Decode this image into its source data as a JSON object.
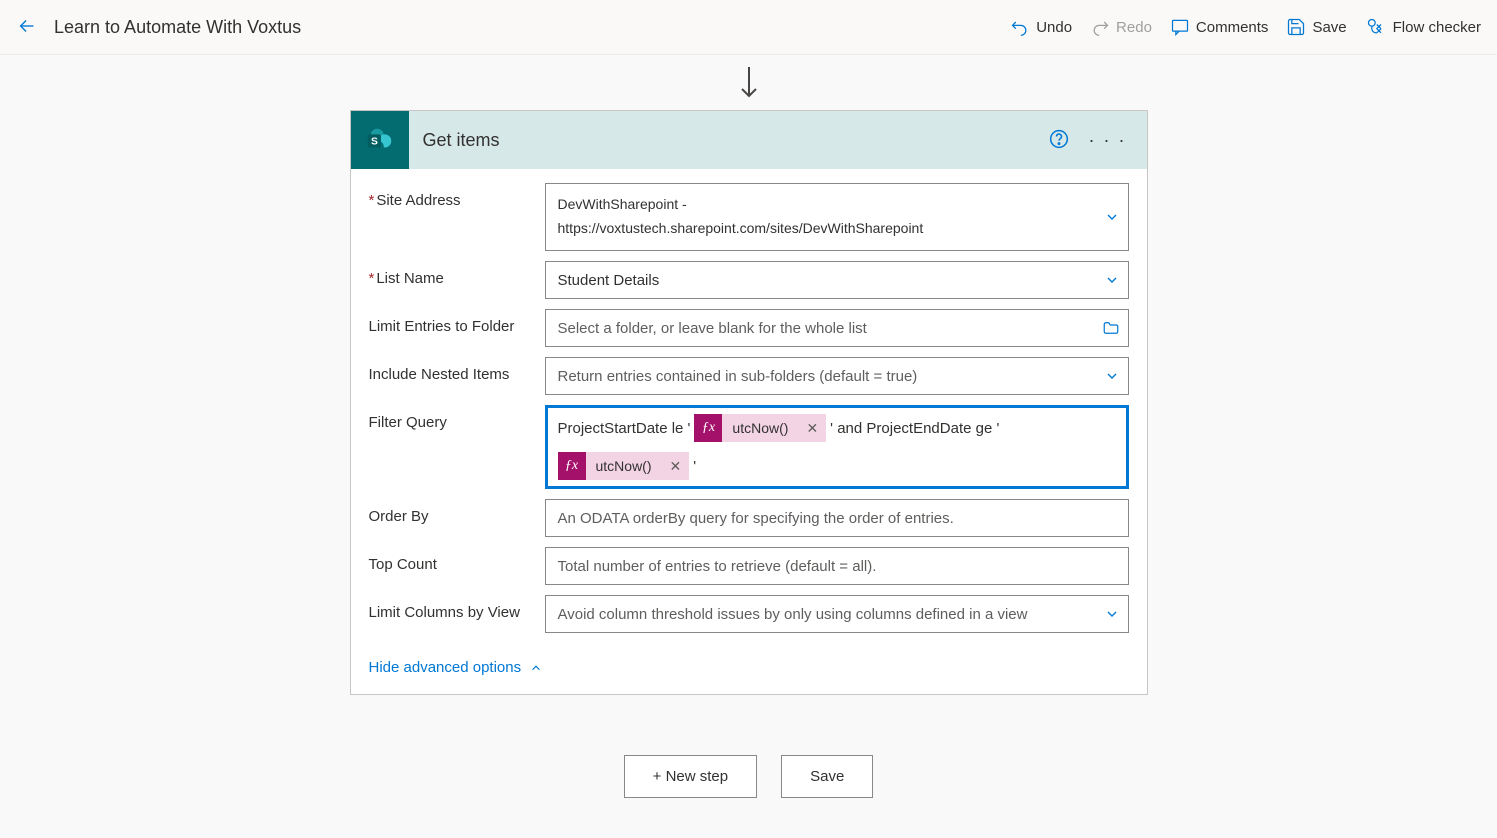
{
  "topbar": {
    "title": "Learn to Automate With Voxtus",
    "undo": "Undo",
    "redo": "Redo",
    "comments": "Comments",
    "save": "Save",
    "flow_checker": "Flow checker"
  },
  "action": {
    "title": "Get items",
    "fields": {
      "site_address": {
        "label": "Site Address",
        "value_line1": "DevWithSharepoint -",
        "value_line2": "https://voxtustech.sharepoint.com/sites/DevWithSharepoint"
      },
      "list_name": {
        "label": "List Name",
        "value": "Student Details"
      },
      "limit_folder": {
        "label": "Limit Entries to Folder",
        "placeholder": "Select a folder, or leave blank for the whole list"
      },
      "include_nested": {
        "label": "Include Nested Items",
        "placeholder": "Return entries contained in sub-folders (default = true)"
      },
      "filter_query": {
        "label": "Filter Query",
        "text_before": "ProjectStartDate le '",
        "token1": "utcNow()",
        "text_mid": "' and ProjectEndDate ge '",
        "token2": "utcNow()",
        "text_after": "'"
      },
      "order_by": {
        "label": "Order By",
        "placeholder": "An ODATA orderBy query for specifying the order of entries."
      },
      "top_count": {
        "label": "Top Count",
        "placeholder": "Total number of entries to retrieve (default = all)."
      },
      "limit_columns": {
        "label": "Limit Columns by View",
        "placeholder": "Avoid column threshold issues by only using columns defined in a view"
      }
    },
    "hide_advanced": "Hide advanced options"
  },
  "footer": {
    "new_step": "+ New step",
    "save": "Save"
  }
}
